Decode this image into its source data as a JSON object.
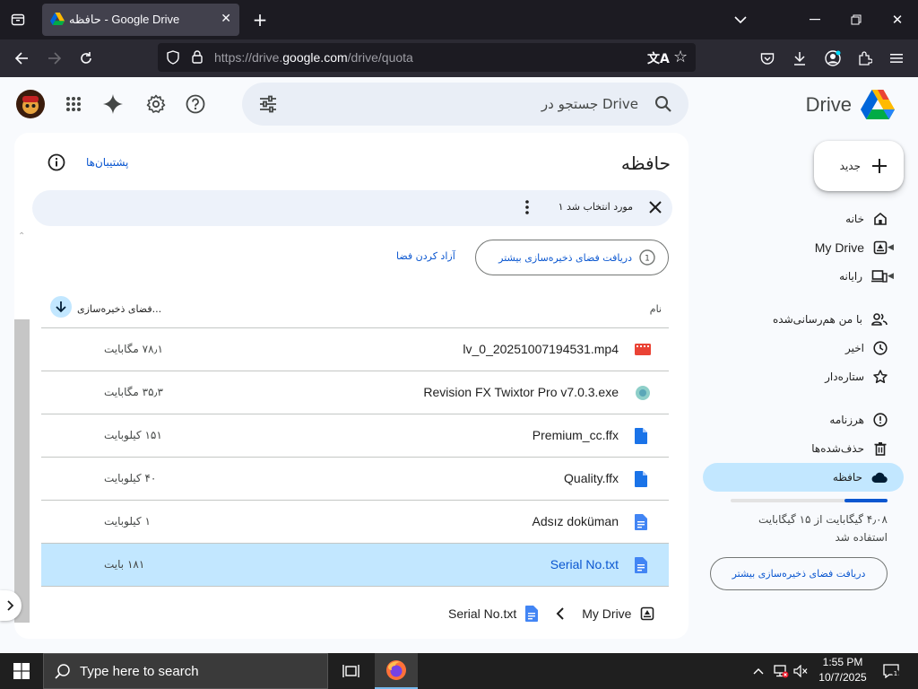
{
  "browser": {
    "tab_title": "حافظه - Google Drive",
    "url_prefix": "https://drive.",
    "url_domain": "google.com",
    "url_path": "/drive/quota"
  },
  "header": {
    "brand": "Drive",
    "search_placeholder": "جستجو در Drive"
  },
  "sidebar": {
    "new_label": "جدید",
    "items": [
      {
        "label": "خانه",
        "icon": "home-icon"
      },
      {
        "label": "My Drive",
        "icon": "my-drive-icon"
      },
      {
        "label": "رایانه",
        "icon": "computers-icon"
      },
      {
        "label": "با من هم‌رسانی‌شده",
        "icon": "shared-icon"
      },
      {
        "label": "اخیر",
        "icon": "clock-icon"
      },
      {
        "label": "ستاره‌دار",
        "icon": "star-icon"
      },
      {
        "label": "هرزنامه",
        "icon": "spam-icon"
      },
      {
        "label": "حذف‌شده‌ها",
        "icon": "trash-icon"
      },
      {
        "label": "حافظه",
        "icon": "cloud-icon"
      }
    ],
    "storage_used_line": "۴٫۰۸ گیگابایت از ۱۵ گیگابایت",
    "storage_used_line2": "استفاده شد",
    "storage_fraction": 0.272,
    "get_storage": "دریافت فضای ذخیره‌سازی بیشتر"
  },
  "main": {
    "title": "حافظه",
    "backups_link": "پشتیبان‌ها",
    "selection_text": "۱ مورد انتخاب شد",
    "get_storage": "دریافت فضای ذخیره‌سازی بیشتر",
    "free_space": "آزاد کردن فضا",
    "col_name": "نام",
    "col_storage": "فضای ذخیره‌سازی...",
    "files": [
      {
        "name": "lv_0_20251007194531.mp4",
        "size": "۷۸٫۱ مگابایت",
        "type": "video"
      },
      {
        "name": "Revision FX Twixtor Pro v7.0.3.exe",
        "size": "۳۵٫۳ مگابایت",
        "type": "exe"
      },
      {
        "name": "Premium_cc.ffx",
        "size": "۱۵۱ کیلوبایت",
        "type": "file"
      },
      {
        "name": "Quality.ffx",
        "size": "۴۰ کیلوبایت",
        "type": "file"
      },
      {
        "name": "Adsız doküman",
        "size": "۱ کیلوبایت",
        "type": "doc"
      },
      {
        "name": "Serial No.txt",
        "size": "۱۸۱ بایت",
        "type": "doc",
        "selected": true
      }
    ],
    "crumb_root": "My Drive",
    "crumb_file": "Serial No.txt"
  },
  "taskbar": {
    "search_placeholder": "Type here to search",
    "time": "1:55 PM",
    "date": "10/7/2025"
  }
}
